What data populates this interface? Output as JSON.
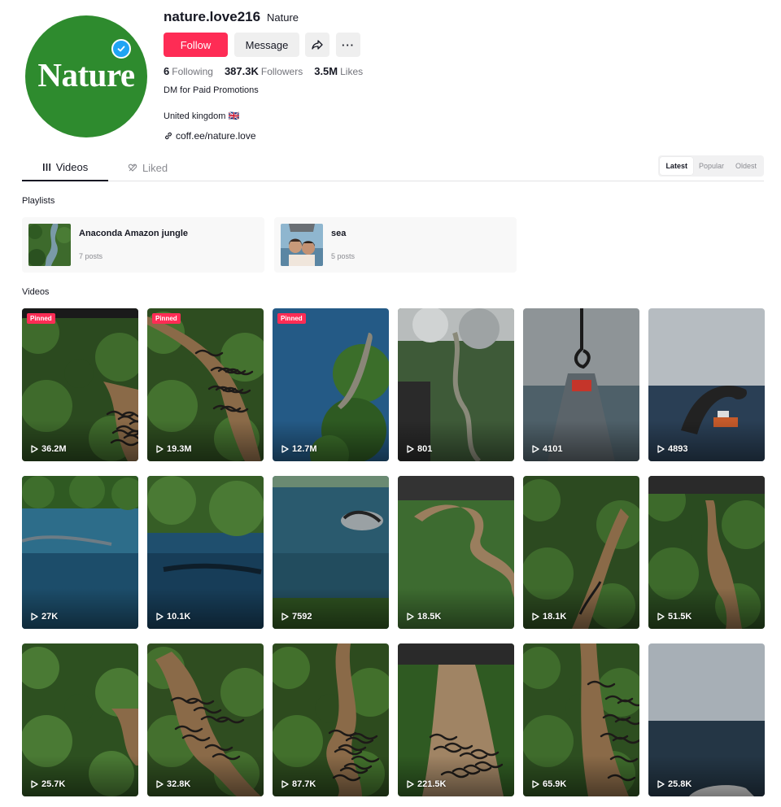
{
  "profile": {
    "avatar_text": "Nature",
    "username": "nature.love216",
    "nickname": "Nature",
    "follow_label": "Follow",
    "message_label": "Message",
    "more_label": "···",
    "stats": {
      "following_count": "6",
      "following_label": "Following",
      "followers_count": "387.3K",
      "followers_label": "Followers",
      "likes_count": "3.5M",
      "likes_label": "Likes"
    },
    "bio": "DM for Paid Promotions",
    "location": "United kingdom 🇬🇧",
    "link": "coff.ee/nature.love"
  },
  "tabs": {
    "videos": "Videos",
    "liked": "Liked"
  },
  "sort": {
    "latest": "Latest",
    "popular": "Popular",
    "oldest": "Oldest",
    "selected": "Latest"
  },
  "playlists": {
    "heading": "Playlists",
    "items": [
      {
        "title": "Anaconda Amazon jungle",
        "count": "7 posts"
      },
      {
        "title": "sea",
        "count": "5 posts"
      }
    ]
  },
  "videos": {
    "heading": "Videos",
    "pinned_label": "Pinned",
    "items": [
      {
        "views": "36.2M",
        "pinned": true
      },
      {
        "views": "19.3M",
        "pinned": true
      },
      {
        "views": "12.7M",
        "pinned": true
      },
      {
        "views": "801",
        "pinned": false
      },
      {
        "views": "4101",
        "pinned": false
      },
      {
        "views": "4893",
        "pinned": false
      },
      {
        "views": "27K",
        "pinned": false
      },
      {
        "views": "10.1K",
        "pinned": false
      },
      {
        "views": "7592",
        "pinned": false
      },
      {
        "views": "18.5K",
        "pinned": false
      },
      {
        "views": "18.1K",
        "pinned": false
      },
      {
        "views": "51.5K",
        "pinned": false
      },
      {
        "views": "25.7K",
        "pinned": false
      },
      {
        "views": "32.8K",
        "pinned": false
      },
      {
        "views": "87.7K",
        "pinned": false
      },
      {
        "views": "221.5K",
        "pinned": false
      },
      {
        "views": "65.9K",
        "pinned": false
      },
      {
        "views": "25.8K",
        "pinned": false
      }
    ]
  },
  "colors": {
    "accent": "#fe2c55",
    "avatar_bg": "#2e8b2e",
    "verified": "#20a4f3"
  }
}
